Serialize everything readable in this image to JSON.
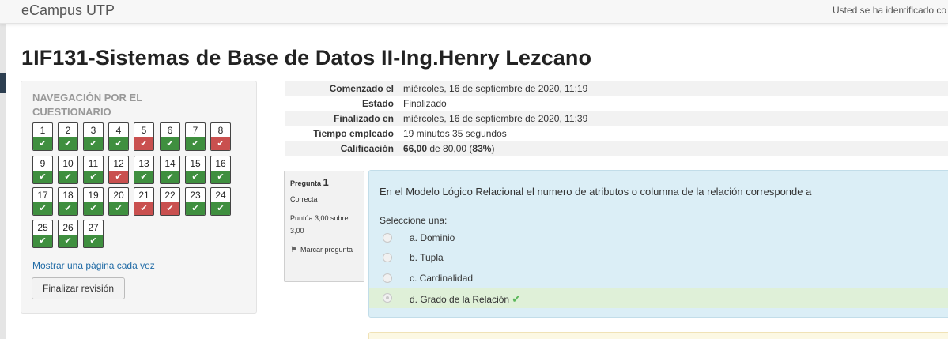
{
  "header": {
    "brand": "eCampus UTP",
    "user_text": "Usted se ha identificado co"
  },
  "page_title": "1IF131-Sistemas de Base de Datos II-Ing.Henry Lezcano",
  "quiz_nav": {
    "title": "NAVEGACIÓN POR EL CUESTIONARIO",
    "questions": [
      {
        "num": "1",
        "state": "correct"
      },
      {
        "num": "2",
        "state": "correct"
      },
      {
        "num": "3",
        "state": "correct"
      },
      {
        "num": "4",
        "state": "correct"
      },
      {
        "num": "5",
        "state": "incorrect"
      },
      {
        "num": "6",
        "state": "correct"
      },
      {
        "num": "7",
        "state": "correct"
      },
      {
        "num": "8",
        "state": "incorrect"
      },
      {
        "num": "9",
        "state": "correct"
      },
      {
        "num": "10",
        "state": "correct"
      },
      {
        "num": "11",
        "state": "correct"
      },
      {
        "num": "12",
        "state": "incorrect"
      },
      {
        "num": "13",
        "state": "correct"
      },
      {
        "num": "14",
        "state": "correct"
      },
      {
        "num": "15",
        "state": "correct"
      },
      {
        "num": "16",
        "state": "correct"
      },
      {
        "num": "17",
        "state": "correct"
      },
      {
        "num": "18",
        "state": "correct"
      },
      {
        "num": "19",
        "state": "correct"
      },
      {
        "num": "20",
        "state": "correct"
      },
      {
        "num": "21",
        "state": "incorrect"
      },
      {
        "num": "22",
        "state": "incorrect"
      },
      {
        "num": "23",
        "state": "correct"
      },
      {
        "num": "24",
        "state": "correct"
      },
      {
        "num": "25",
        "state": "correct"
      },
      {
        "num": "26",
        "state": "correct"
      },
      {
        "num": "27",
        "state": "correct"
      }
    ],
    "show_one_page_link": "Mostrar una página cada vez",
    "finish_button": "Finalizar revisión"
  },
  "summary": [
    {
      "label": "Comenzado el",
      "value": "miércoles, 16 de septiembre de 2020, 11:19"
    },
    {
      "label": "Estado",
      "value": "Finalizado"
    },
    {
      "label": "Finalizado en",
      "value": "miércoles, 16 de septiembre de 2020, 11:39"
    },
    {
      "label": "Tiempo empleado",
      "value": "19 minutos 35 segundos"
    },
    {
      "label": "Calificación",
      "value_bold": "66,00",
      "value_mid": " de 80,00 (",
      "value_pct": "83%",
      "value_end": ")"
    }
  ],
  "question1": {
    "label": "Pregunta",
    "number": "1",
    "state": "Correcta",
    "grade": "Puntúa 3,00 sobre 3,00",
    "flag_label": "Marcar pregunta",
    "text": "En el Modelo Lógico Relacional el numero de atributos o columna de la relación corresponde a",
    "prompt": "Seleccione una:",
    "answers": [
      {
        "text": "a. Dominio"
      },
      {
        "text": "b. Tupla"
      },
      {
        "text": "c. Cardinalidad"
      },
      {
        "text": "d. Grado de la Relación"
      }
    ],
    "selected_answer": "d. Grado de la Relación",
    "check_icon": "check-icon"
  },
  "colors": {
    "correct": "#3f8f3f",
    "incorrect": "#c9504f",
    "question_bg": "#dbeef6",
    "correct_answer_bg": "#dff0d8"
  }
}
